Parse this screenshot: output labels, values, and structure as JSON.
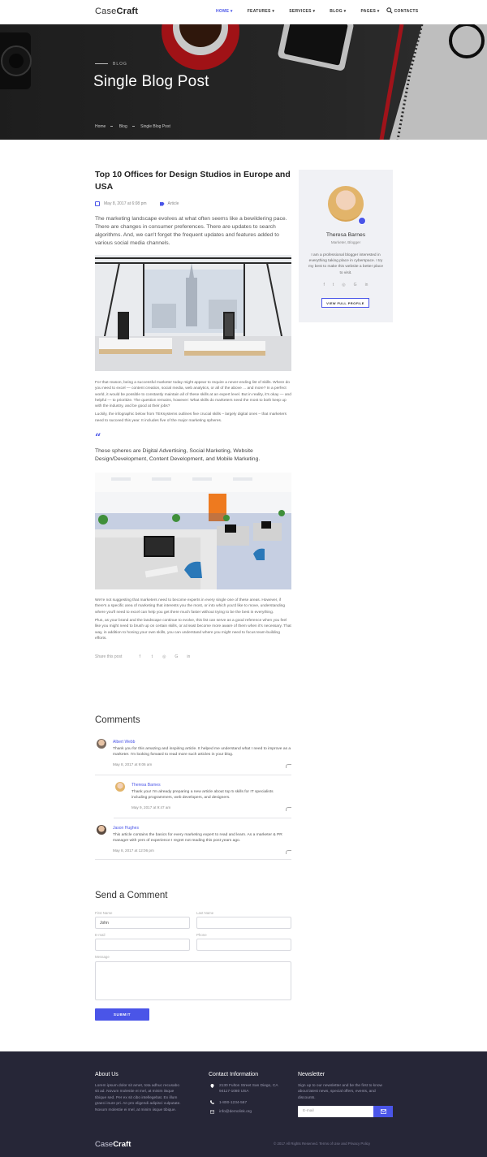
{
  "header": {
    "logo_light": "Case",
    "logo_bold": "Craft",
    "nav": [
      "HOME",
      "FEATURES",
      "SERVICES",
      "BLOG",
      "PAGES",
      "CONTACTS"
    ],
    "active_nav": "HOME"
  },
  "hero": {
    "kicker": "BLOG",
    "title": "Single Blog Post",
    "breadcrumbs": [
      "Home",
      "Blog",
      "Single Blog Post"
    ]
  },
  "article": {
    "title": "Top 10 Offices for Design Studios in Europe and USA",
    "date": "May 8, 2017 at 6:08 pm",
    "category": "Article",
    "lead": "The marketing landscape evolves at what often seems like a bewildering pace. There are changes in consumer preferences. There are updates to search algorithms. And, we can't forget the frequent updates and features added to various social media channels.",
    "p1": "For that reason, being a successful marketer today might appear to require a never-ending list of skills. Where do you need to excel — content creation, social media, web analytics, or all of the above ... and more? In a perfect world, it would be possible to constantly maintain all of these skills at an expert level. But in reality, it's okay — and helpful — to prioritize. The question remains, however: What skills do marketers need the most to both keep up with the industry, and be good at their jobs?",
    "p2": "Luckily, the infographic below from TEKsystems outlines five crucial skills – largely digital ones – that marketers need to succeed this year. It includes five of the major marketing spheres.",
    "quote": "These spheres are Digital Advertising, Social Marketing, Website Design/Development, Content Development, and Mobile Marketing.",
    "p3": "We're not suggesting that marketers need to become experts in every single one of these areas. However, if there's a specific area of marketing that interests you the most, or into which you'd like to move, understanding where you'll need to excel can help you get there much faster without trying to be the best in everything.",
    "p4": "Plus, as your brand and the landscape continue to evolve, this list can serve as a good reference when you feel like you might need to brush up on certain skills, or at least become more aware of them when it's necessary. That way, in addition to honing your own skills, you can understand where you might need to focus team-building efforts.",
    "share_label": "Share this post",
    "share_icons": [
      "f",
      "t",
      "◎",
      "G",
      "in"
    ]
  },
  "author": {
    "name": "Theresa Barnes",
    "role": "Marketer, Blogger",
    "bio": "I am a professional blogger interested in everything taking place in cyberspace. I try my best to make this website a better place to visit.",
    "social": [
      "f",
      "t",
      "◎",
      "G",
      "in"
    ],
    "button": "VIEW FULL PROFILE"
  },
  "comments": {
    "title": "Comments",
    "items": [
      {
        "name": "Albert Webb",
        "text": "Thank you for this amazing and inspiring article. It helped me understand what I need to improve as a marketer. I'm looking forward to read more such articles in your blog.",
        "date": "May 8, 2017 at 9:06 am"
      },
      {
        "name": "Theresa Barnes",
        "text": "Thank you! I'm already preparing a new article about top 5 skills for IT specialists including programmers, web developers, and designers.",
        "date": "May 9, 2017 at 9:47 am"
      },
      {
        "name": "Jason Hughes",
        "text": "This article contains the basics for every marketing expert to read and learn. As a marketer & PR manager with yers of experience I regret not reading this post years ago.",
        "date": "May 8, 2017 at 12:06 pm"
      }
    ]
  },
  "form": {
    "title": "Send a Comment",
    "first_name_label": "First Name",
    "first_name_value": "John",
    "last_name_label": "Last Name",
    "email_label": "E-mail",
    "phone_label": "Phone",
    "message_label": "Message",
    "submit": "SUBMIT"
  },
  "footer": {
    "about_title": "About Us",
    "about_text": "Lorem ipsum dolor sit amet, tota adhuc recusabo sit ad. Novum molestie ei mel, at minim iisque tibique sed. Per ex sit cibo intellegebat. Ex illum graeci inure pri. An pro eligendi adipisci vulputate. Novum molestie ei mel, at minim iisque tibique.",
    "contact_title": "Contact Information",
    "address": "2130 Fulton Street San Diego, CA 94117-1080 USA",
    "phone": "1-800-1234-567",
    "email": "info@demolink.org",
    "newsletter_title": "Newsletter",
    "newsletter_text": "Sign up to our newsletter and be the first to know about latest news, special offers, events, and discounts.",
    "newsletter_placeholder": "E-mail",
    "logo_light": "Case",
    "logo_bold": "Craft",
    "copyright": "© 2017 All Rights Reserved. Terms of Use and Privacy Policy"
  },
  "colors": {
    "accent": "#4a55e8",
    "footer_bg": "#262637",
    "card_bg": "#f0f1f5"
  }
}
